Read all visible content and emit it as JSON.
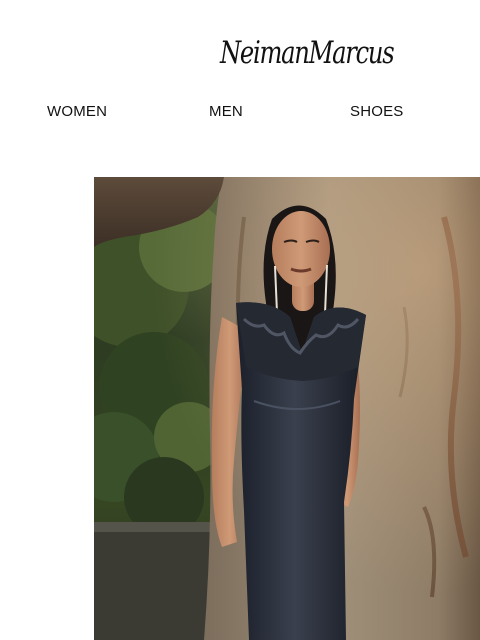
{
  "brand": {
    "logo_text": "NeimanMarcus"
  },
  "nav": {
    "items": [
      {
        "label": "WOMEN"
      },
      {
        "label": "MEN"
      },
      {
        "label": "SHOES"
      }
    ]
  },
  "hero": {
    "colors": {
      "foliage": "#2f3d22",
      "bark": "#9a8a73",
      "dress": "#202733"
    }
  }
}
